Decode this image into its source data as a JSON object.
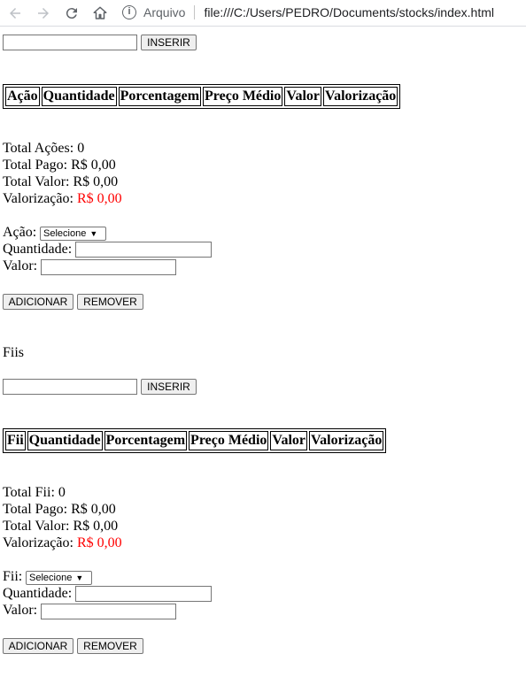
{
  "browser": {
    "address_prefix": "Arquivo",
    "url": "file:///C:/Users/PEDRO/Documents/stocks/index.html"
  },
  "acoes": {
    "insert_input_value": "",
    "insert_label": "INSERIR",
    "table_headers": [
      "Ação",
      "Quantidade",
      "Porcentagem",
      "Preço Médio",
      "Valor",
      "Valorização"
    ],
    "totals": {
      "count_label": "Total Ações:",
      "count_value": "0",
      "pago_label": "Total Pago:",
      "pago_value": "R$ 0,00",
      "valor_label": "Total Valor:",
      "valor_value": "R$ 0,00",
      "valorizacao_label": "Valorização:",
      "valorizacao_value": "R$ 0,00"
    },
    "form": {
      "select_label": "Ação:",
      "select_value": "Selecione",
      "quantidade_label": "Quantidade:",
      "valor_label": "Valor:",
      "adicionar_label": "ADICIONAR",
      "remover_label": "REMOVER"
    }
  },
  "fiis": {
    "section_title": "Fiis",
    "insert_input_value": "",
    "insert_label": "INSERIR",
    "table_headers": [
      "Fii",
      "Quantidade",
      "Porcentagem",
      "Preço Médio",
      "Valor",
      "Valorização"
    ],
    "totals": {
      "count_label": "Total Fii:",
      "count_value": "0",
      "pago_label": "Total Pago:",
      "pago_value": "R$ 0,00",
      "valor_label": "Total Valor:",
      "valor_value": "R$ 0,00",
      "valorizacao_label": "Valorização:",
      "valorizacao_value": "R$ 0,00"
    },
    "form": {
      "select_label": "Fii:",
      "select_value": "Selecione",
      "quantidade_label": "Quantidade:",
      "valor_label": "Valor:",
      "adicionar_label": "ADICIONAR",
      "remover_label": "REMOVER"
    }
  },
  "colors": {
    "negative": "#ff0000"
  }
}
